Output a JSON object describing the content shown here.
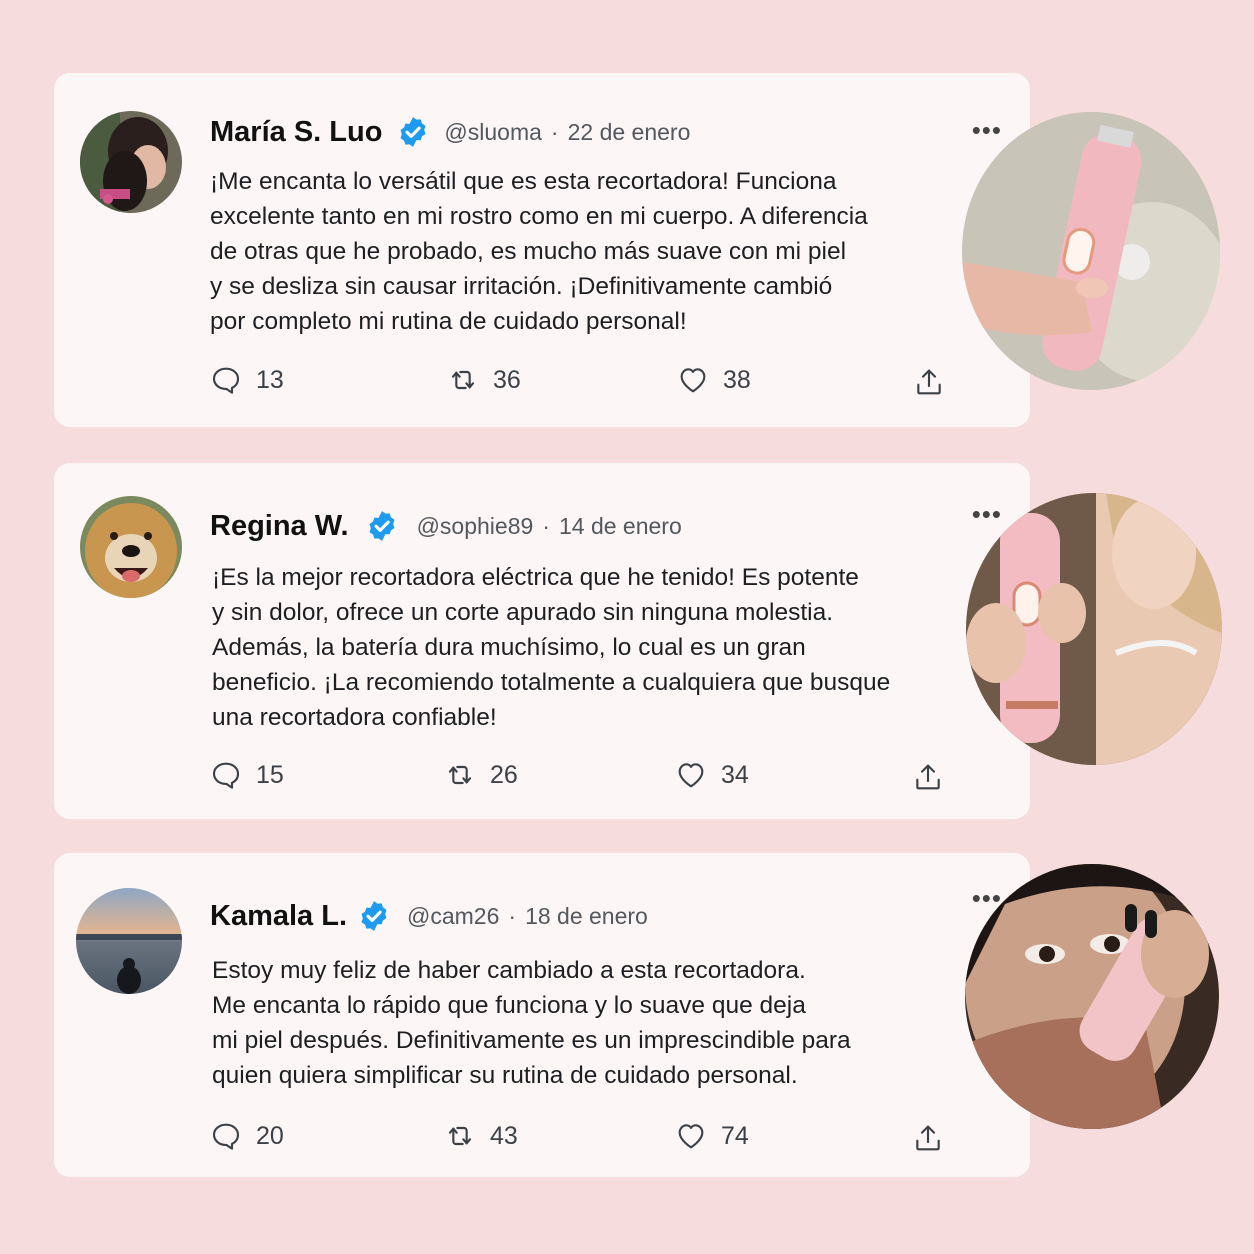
{
  "colors": {
    "background": "#f6dcdc",
    "card": "#fcf6f6",
    "verified_badge": "#1d9bf0",
    "icon_stroke": "#3c4148"
  },
  "icons": {
    "reply": "reply-icon",
    "retweet": "retweet-icon",
    "like": "heart-icon",
    "share": "share-icon",
    "more": "more-icon",
    "verified": "verified-badge-icon"
  },
  "more_glyph": "•••",
  "tweets": [
    {
      "name": "María S. Luo",
      "handle": "@sluoma",
      "separator": "·",
      "date": "22 de enero",
      "lines": [
        "¡Me encanta lo versátil que es esta recortadora! Funciona",
        "excelente tanto en mi rostro como en mi cuerpo. A diferencia",
        "de otras que he probado, es mucho más suave con mi piel",
        "y se desliza sin causar irritación. ¡Definitivamente cambió",
        "por completo mi rutina de cuidado personal!"
      ],
      "replies": "13",
      "retweets": "36",
      "likes": "38"
    },
    {
      "name": "Regina W.",
      "handle": "@sophie89",
      "separator": "·",
      "date": "14 de enero",
      "lines": [
        "¡Es la mejor recortadora eléctrica que he tenido! Es potente",
        "y sin dolor, ofrece un corte apurado sin ninguna molestia.",
        "Además, la batería dura muchísimo, lo cual es un gran",
        "beneficio. ¡La recomiendo totalmente a cualquiera que busque",
        "una recortadora confiable!"
      ],
      "replies": "15",
      "retweets": "26",
      "likes": "34"
    },
    {
      "name": "Kamala L.",
      "handle": "@cam26",
      "separator": "·",
      "date": "18 de enero",
      "lines": [
        "Estoy muy feliz de haber cambiado a esta recortadora.",
        "Me encanta lo rápido que funciona y lo suave que deja",
        "mi piel después. Definitivamente es un imprescindible para",
        "quien quiera simplificar su rutina de cuidado personal."
      ],
      "replies": "20",
      "retweets": "43",
      "likes": "74"
    }
  ]
}
